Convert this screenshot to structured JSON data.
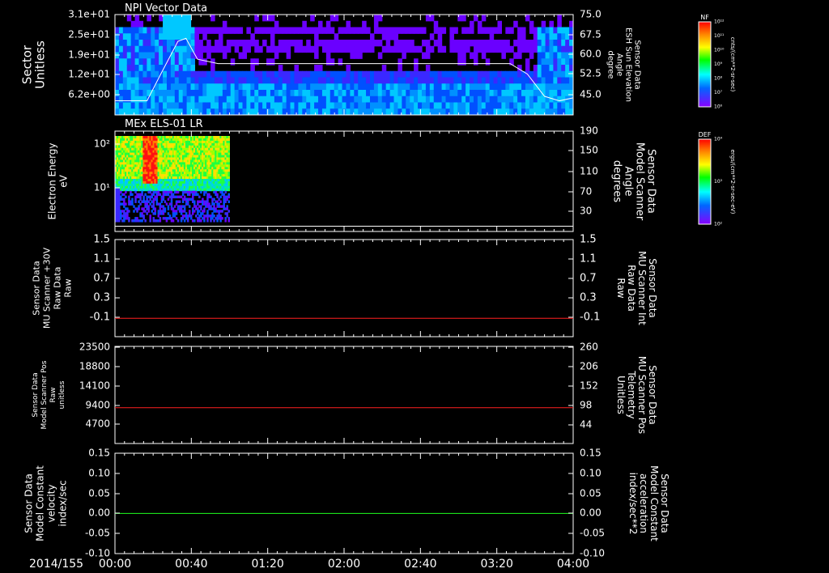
{
  "date": "2014/155",
  "time_ticks": [
    "00:00",
    "00:40",
    "01:20",
    "02:00",
    "02:40",
    "03:20",
    "04:00"
  ],
  "colors": {
    "white": "#ffffff",
    "red": "#ff2020",
    "green": "#20ff20",
    "black": "#000000"
  },
  "chart_data": [
    {
      "type": "heatmap",
      "title": "NPI Vector Data",
      "ylabel": [
        "Sector",
        "Unitless"
      ],
      "y_ticks": [
        "3.1e+01",
        "2.5e+01",
        "1.9e+01",
        "1.2e+01",
        "6.2e+00"
      ],
      "y2label": [
        "Sensor Data",
        "ESH Sun Elevation",
        "Angle",
        "degree"
      ],
      "y2_ticks": [
        "75.0",
        "67.5",
        "60.0",
        "52.5",
        "45.0"
      ],
      "y2lim": [
        41.25,
        75
      ],
      "overlay": {
        "color": "#ffffff",
        "x_hours": [
          0,
          0.28,
          0.4,
          0.55,
          0.62,
          0.72,
          0.9,
          3.45,
          3.6,
          3.75,
          3.88,
          4.0
        ],
        "y": [
          46,
          46,
          55,
          66,
          67,
          60,
          58.5,
          58.5,
          55,
          47.5,
          46,
          47
        ]
      },
      "colorbar": {
        "label": "NF",
        "unit": "cnts/(cm**2-sr-sec)",
        "ticks": [
          "10¹²",
          "10¹¹",
          "10¹⁰",
          "10⁹",
          "10⁸",
          "10⁷",
          "10⁶"
        ]
      }
    },
    {
      "type": "heatmap",
      "title": "MEx ELS-01 LR",
      "ylabel": [
        "Electron Energy",
        "eV"
      ],
      "y_ticks": [
        "10²",
        "10¹"
      ],
      "y2label": [
        "Sensor Data",
        "Model Scanner",
        "Angle",
        "degrees"
      ],
      "y2_ticks": [
        "190",
        "150",
        "110",
        "70",
        "30"
      ],
      "y2lim": [
        0,
        190
      ],
      "overlay": {
        "color": "#ffffff",
        "y": 10
      },
      "data_end_hours": 1.0,
      "colorbar": {
        "label": "DEF",
        "unit": "ergs/(cm**2-sr-sec-eV)",
        "ticks": [
          "10⁴",
          "10³",
          "10²"
        ]
      }
    },
    {
      "type": "line",
      "ylabel": [
        "Sensor Data",
        "MU Scanner +30V",
        "Raw Data",
        "Raw"
      ],
      "y_ticks": [
        "1.5",
        "1.1",
        "0.7",
        "0.3",
        "-0.1"
      ],
      "ylim": [
        -0.35,
        1.5
      ],
      "y2label": [
        "Sensor Data",
        "MU Scanner Int",
        "Raw Data",
        "Raw"
      ],
      "y2_ticks": [
        "1.5",
        "1.1",
        "0.7",
        "0.3",
        "-0.1"
      ],
      "series": [
        {
          "color": "#ff2020",
          "values": [
            0.0,
            0.0
          ]
        }
      ]
    },
    {
      "type": "line",
      "ylabel": [
        "Sensor Data",
        "Model Scanner Pos",
        "Raw",
        "unitless"
      ],
      "y_ticks": [
        "23500",
        "18800",
        "14100",
        "9400",
        "4700"
      ],
      "ylim": [
        -1000,
        23500
      ],
      "y2label": [
        "Sensor Data",
        "MU Scanner Pos",
        "Telemetry",
        "Unitless"
      ],
      "y2_ticks": [
        "260",
        "206",
        "152",
        "98",
        "44"
      ],
      "y2lim": [
        -11,
        260
      ],
      "series": [
        {
          "color": "#ff2020",
          "values": [
            89,
            89
          ]
        }
      ]
    },
    {
      "type": "line",
      "ylabel": [
        "Sensor Data",
        "Model Constant",
        "velocity",
        "index/sec"
      ],
      "y_ticks": [
        "0.15",
        "0.10",
        "0.05",
        "0.00",
        "-0.05",
        "-0.10"
      ],
      "ylim": [
        -0.1,
        0.15
      ],
      "y2label": [
        "Sensor Data",
        "Model Constant",
        "acceleration",
        "index/sec**2"
      ],
      "y2_ticks": [
        "0.15",
        "0.10",
        "0.05",
        "0.00",
        "-0.05",
        "-0.10"
      ],
      "series": [
        {
          "color": "#20ff20",
          "values": [
            0.0,
            0.0
          ]
        }
      ]
    }
  ]
}
